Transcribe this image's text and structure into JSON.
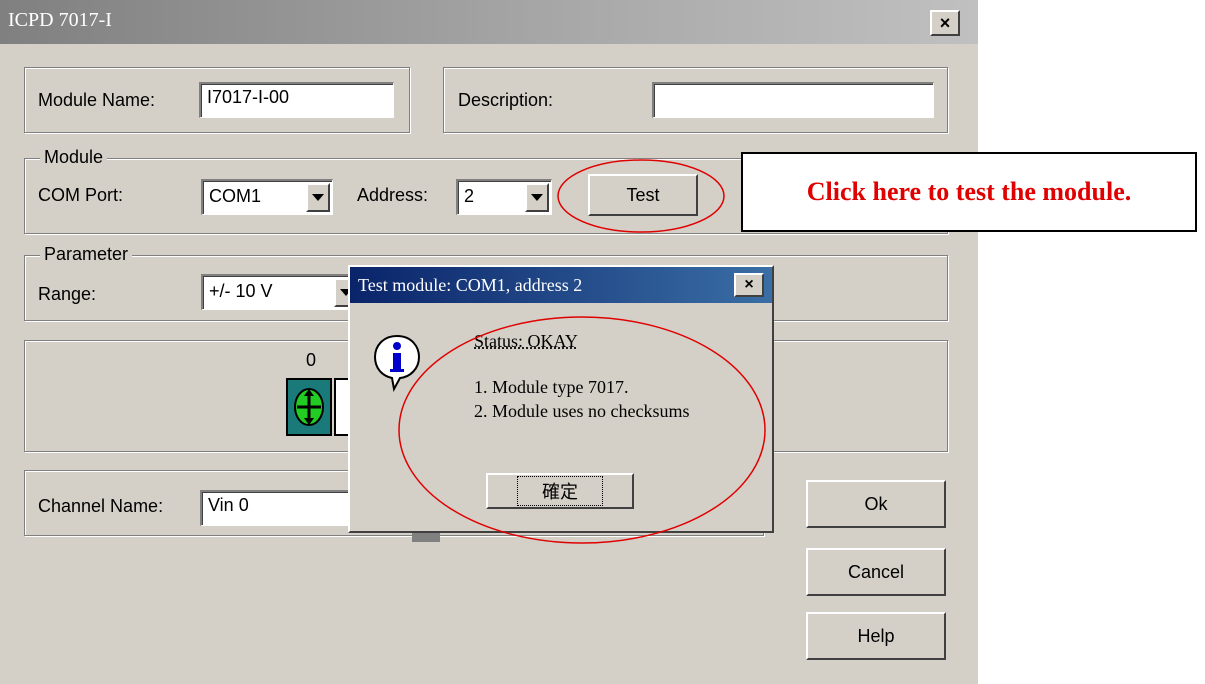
{
  "window": {
    "title": "ICPD 7017-I",
    "close_glyph": "×"
  },
  "module_name": {
    "label": "Module Name:",
    "value": "I7017-I-00"
  },
  "description": {
    "label": "Description:",
    "value": ""
  },
  "module_group": {
    "title": "Module",
    "com_port_label": "COM Port:",
    "com_port_value": "COM1",
    "address_label": "Address:",
    "address_value": "2",
    "test_label": "Test"
  },
  "parameter_group": {
    "title": "Parameter",
    "range_label": "Range:",
    "range_value": "+/- 10 V"
  },
  "channels": {
    "index_label": "0"
  },
  "channel_name": {
    "label": "Channel Name:",
    "value": "Vin 0"
  },
  "buttons": {
    "ok": "Ok",
    "cancel": "Cancel",
    "help": "Help"
  },
  "dialog": {
    "title": "Test module: COM1, address 2",
    "close_glyph": "×",
    "status": "Status: OKAY",
    "line1": "1. Module type 7017.",
    "line2": "2. Module uses no checksums",
    "confirm": "確定",
    "icon": "info-icon"
  },
  "callout": {
    "text": "Click here to test the module."
  },
  "colors": {
    "annotation_red": "#e00000",
    "dialog_title_blue": "#0a246a"
  }
}
